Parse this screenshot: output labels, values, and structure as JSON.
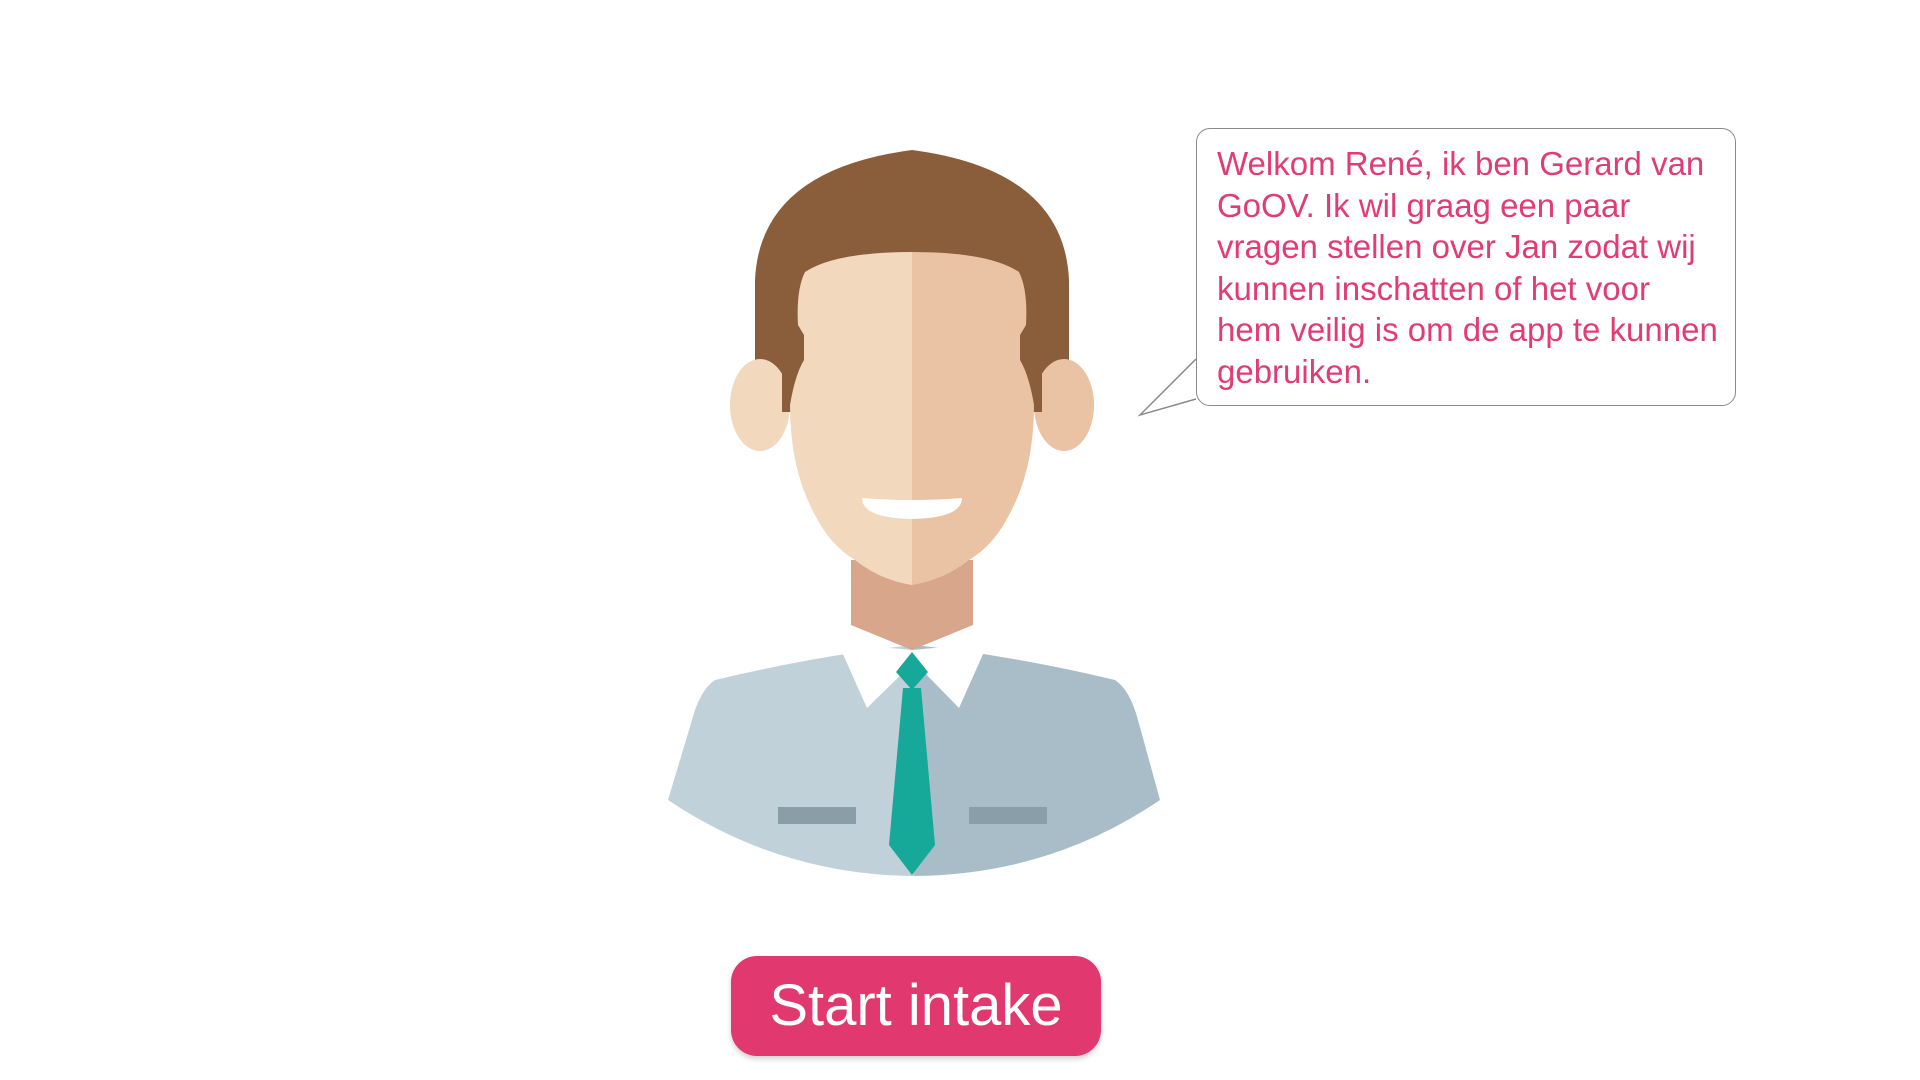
{
  "dialog": {
    "message": "Welkom René, ik ben Gerard van GoOV. Ik wil graag een paar vragen stellen over Jan zodat wij kunnen inschatten of het voor hem veilig is om de app te kunnen gebruiken."
  },
  "actions": {
    "start_label": "Start intake"
  },
  "avatar": {
    "icon": "person-avatar-icon"
  },
  "colors": {
    "accent": "#e0386f",
    "message_text": "#e03c76",
    "hair": "#8a5e3b",
    "skin_light": "#f2d8bd",
    "skin_dark": "#eac2a4",
    "neck": "#d8a68a",
    "shirt_light": "#c0d1d9",
    "shirt_dark": "#a8bdc8",
    "tie": "#16a99a",
    "pocket": "#8a9ea7"
  }
}
